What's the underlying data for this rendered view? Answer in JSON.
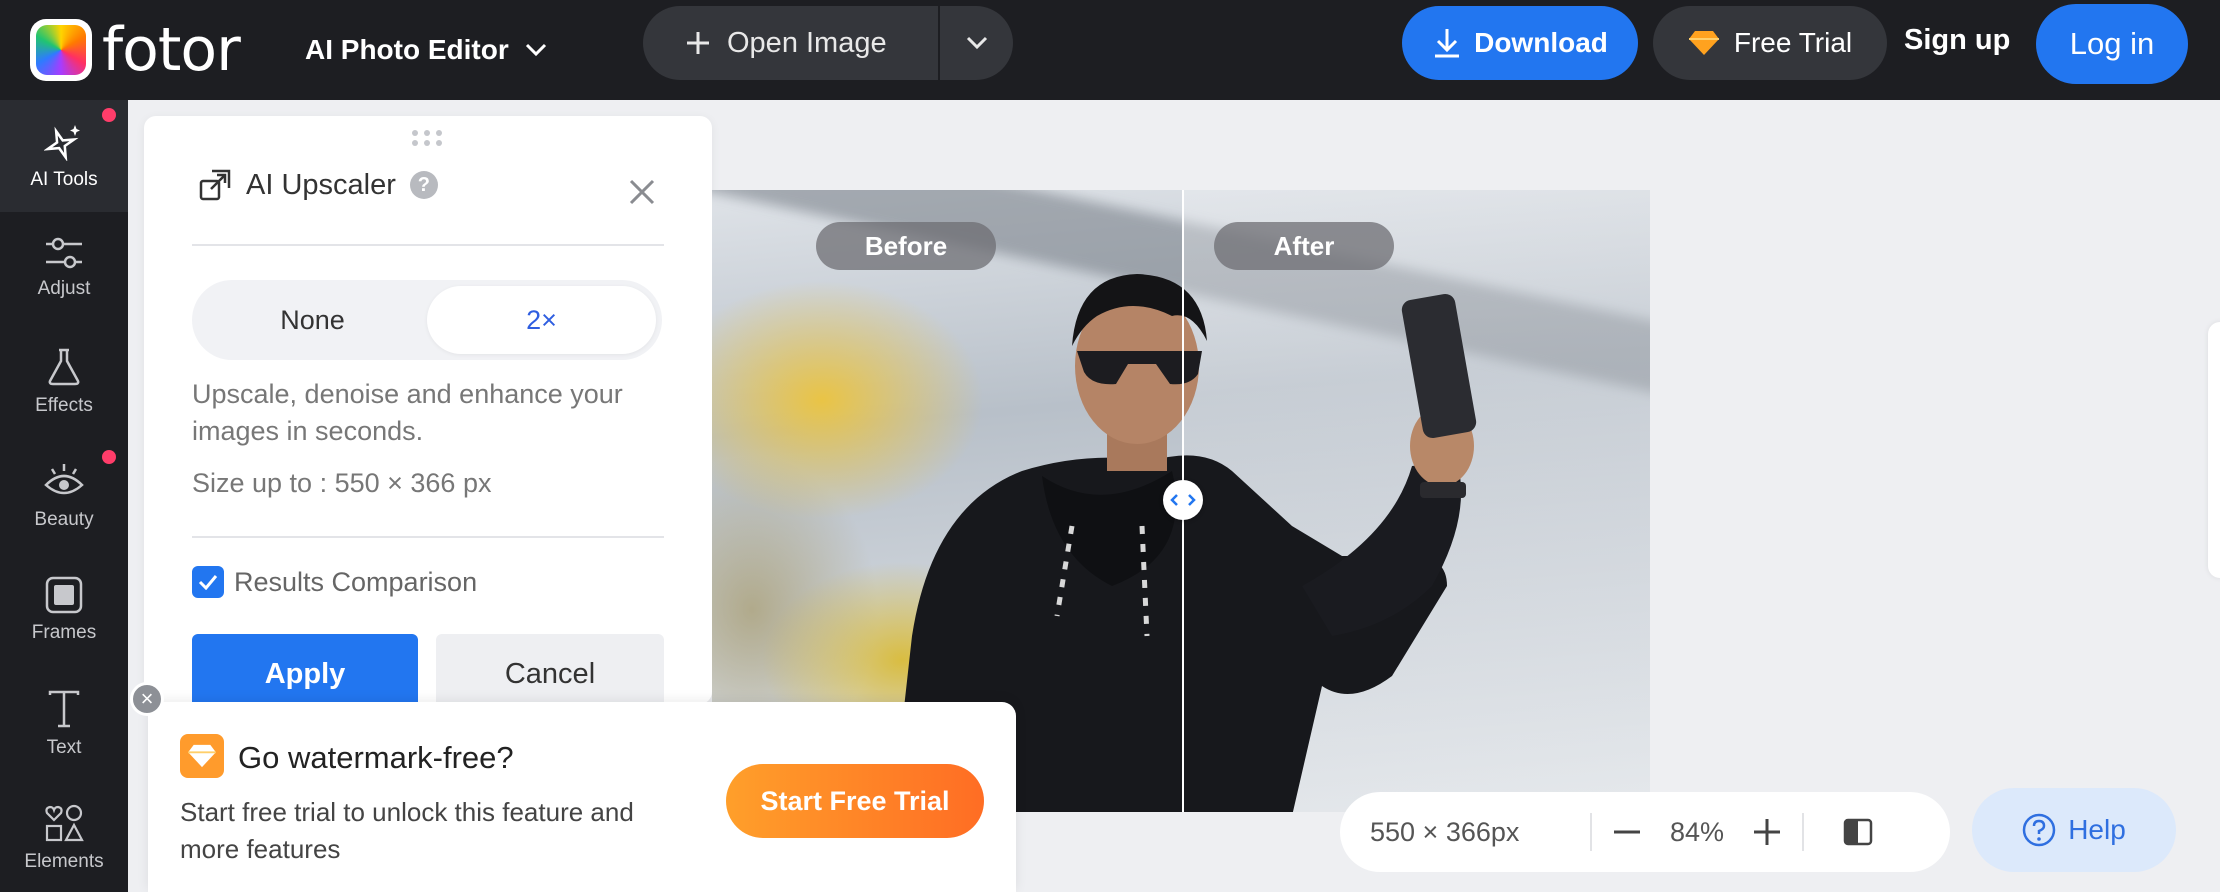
{
  "app": {
    "brand": "fotor",
    "editor_menu": "AI Photo Editor"
  },
  "header": {
    "open_image": "Open Image",
    "download": "Download",
    "free_trial": "Free Trial",
    "sign_up": "Sign up",
    "log_in": "Log in",
    "brand_color": "#2276f0"
  },
  "sidebar": {
    "items": [
      {
        "label": "AI Tools",
        "icon": "sparkle-icon",
        "active": true,
        "dot": true
      },
      {
        "label": "Adjust",
        "icon": "sliders-icon"
      },
      {
        "label": "Effects",
        "icon": "flask-icon"
      },
      {
        "label": "Beauty",
        "icon": "eye-icon",
        "dot": true
      },
      {
        "label": "Frames",
        "icon": "frame-icon"
      },
      {
        "label": "Text",
        "icon": "text-icon"
      },
      {
        "label": "Elements",
        "icon": "shapes-icon"
      }
    ]
  },
  "panel": {
    "title": "AI Upscaler",
    "help_glyph": "?",
    "options": [
      "None",
      "2×"
    ],
    "selected_option": "2×",
    "description": "Upscale, denoise and enhance your images in seconds.",
    "size_note": "Size up to : 550 × 366 px",
    "comparison_label": "Results Comparison",
    "comparison_checked": true,
    "apply": "Apply",
    "cancel": "Cancel"
  },
  "canvas": {
    "before_label": "Before",
    "after_label": "After"
  },
  "promo": {
    "title": "Go watermark-free?",
    "text": "Start free trial to unlock this feature and more features",
    "button": "Start Free Trial"
  },
  "zoom": {
    "dimensions": "550 × 366px",
    "level": "84%"
  },
  "help": {
    "label": "Help"
  }
}
